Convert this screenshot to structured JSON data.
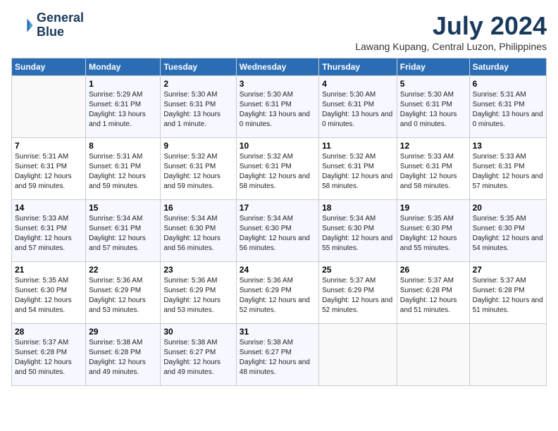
{
  "header": {
    "logo_line1": "General",
    "logo_line2": "Blue",
    "month": "July 2024",
    "location": "Lawang Kupang, Central Luzon, Philippines"
  },
  "weekdays": [
    "Sunday",
    "Monday",
    "Tuesday",
    "Wednesday",
    "Thursday",
    "Friday",
    "Saturday"
  ],
  "weeks": [
    [
      {
        "day": "",
        "sunrise": "",
        "sunset": "",
        "daylight": ""
      },
      {
        "day": "1",
        "sunrise": "5:29 AM",
        "sunset": "6:31 PM",
        "daylight": "13 hours and 1 minute."
      },
      {
        "day": "2",
        "sunrise": "5:30 AM",
        "sunset": "6:31 PM",
        "daylight": "13 hours and 1 minute."
      },
      {
        "day": "3",
        "sunrise": "5:30 AM",
        "sunset": "6:31 PM",
        "daylight": "13 hours and 0 minutes."
      },
      {
        "day": "4",
        "sunrise": "5:30 AM",
        "sunset": "6:31 PM",
        "daylight": "13 hours and 0 minutes."
      },
      {
        "day": "5",
        "sunrise": "5:30 AM",
        "sunset": "6:31 PM",
        "daylight": "13 hours and 0 minutes."
      },
      {
        "day": "6",
        "sunrise": "5:31 AM",
        "sunset": "6:31 PM",
        "daylight": "13 hours and 0 minutes."
      }
    ],
    [
      {
        "day": "7",
        "sunrise": "5:31 AM",
        "sunset": "6:31 PM",
        "daylight": "12 hours and 59 minutes."
      },
      {
        "day": "8",
        "sunrise": "5:31 AM",
        "sunset": "6:31 PM",
        "daylight": "12 hours and 59 minutes."
      },
      {
        "day": "9",
        "sunrise": "5:32 AM",
        "sunset": "6:31 PM",
        "daylight": "12 hours and 59 minutes."
      },
      {
        "day": "10",
        "sunrise": "5:32 AM",
        "sunset": "6:31 PM",
        "daylight": "12 hours and 58 minutes."
      },
      {
        "day": "11",
        "sunrise": "5:32 AM",
        "sunset": "6:31 PM",
        "daylight": "12 hours and 58 minutes."
      },
      {
        "day": "12",
        "sunrise": "5:33 AM",
        "sunset": "6:31 PM",
        "daylight": "12 hours and 58 minutes."
      },
      {
        "day": "13",
        "sunrise": "5:33 AM",
        "sunset": "6:31 PM",
        "daylight": "12 hours and 57 minutes."
      }
    ],
    [
      {
        "day": "14",
        "sunrise": "5:33 AM",
        "sunset": "6:31 PM",
        "daylight": "12 hours and 57 minutes."
      },
      {
        "day": "15",
        "sunrise": "5:34 AM",
        "sunset": "6:31 PM",
        "daylight": "12 hours and 57 minutes."
      },
      {
        "day": "16",
        "sunrise": "5:34 AM",
        "sunset": "6:30 PM",
        "daylight": "12 hours and 56 minutes."
      },
      {
        "day": "17",
        "sunrise": "5:34 AM",
        "sunset": "6:30 PM",
        "daylight": "12 hours and 56 minutes."
      },
      {
        "day": "18",
        "sunrise": "5:34 AM",
        "sunset": "6:30 PM",
        "daylight": "12 hours and 55 minutes."
      },
      {
        "day": "19",
        "sunrise": "5:35 AM",
        "sunset": "6:30 PM",
        "daylight": "12 hours and 55 minutes."
      },
      {
        "day": "20",
        "sunrise": "5:35 AM",
        "sunset": "6:30 PM",
        "daylight": "12 hours and 54 minutes."
      }
    ],
    [
      {
        "day": "21",
        "sunrise": "5:35 AM",
        "sunset": "6:30 PM",
        "daylight": "12 hours and 54 minutes."
      },
      {
        "day": "22",
        "sunrise": "5:36 AM",
        "sunset": "6:29 PM",
        "daylight": "12 hours and 53 minutes."
      },
      {
        "day": "23",
        "sunrise": "5:36 AM",
        "sunset": "6:29 PM",
        "daylight": "12 hours and 53 minutes."
      },
      {
        "day": "24",
        "sunrise": "5:36 AM",
        "sunset": "6:29 PM",
        "daylight": "12 hours and 52 minutes."
      },
      {
        "day": "25",
        "sunrise": "5:37 AM",
        "sunset": "6:29 PM",
        "daylight": "12 hours and 52 minutes."
      },
      {
        "day": "26",
        "sunrise": "5:37 AM",
        "sunset": "6:28 PM",
        "daylight": "12 hours and 51 minutes."
      },
      {
        "day": "27",
        "sunrise": "5:37 AM",
        "sunset": "6:28 PM",
        "daylight": "12 hours and 51 minutes."
      }
    ],
    [
      {
        "day": "28",
        "sunrise": "5:37 AM",
        "sunset": "6:28 PM",
        "daylight": "12 hours and 50 minutes."
      },
      {
        "day": "29",
        "sunrise": "5:38 AM",
        "sunset": "6:28 PM",
        "daylight": "12 hours and 49 minutes."
      },
      {
        "day": "30",
        "sunrise": "5:38 AM",
        "sunset": "6:27 PM",
        "daylight": "12 hours and 49 minutes."
      },
      {
        "day": "31",
        "sunrise": "5:38 AM",
        "sunset": "6:27 PM",
        "daylight": "12 hours and 48 minutes."
      },
      {
        "day": "",
        "sunrise": "",
        "sunset": "",
        "daylight": ""
      },
      {
        "day": "",
        "sunrise": "",
        "sunset": "",
        "daylight": ""
      },
      {
        "day": "",
        "sunrise": "",
        "sunset": "",
        "daylight": ""
      }
    ]
  ]
}
